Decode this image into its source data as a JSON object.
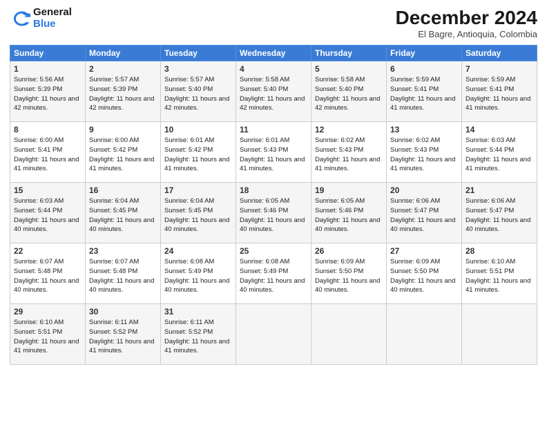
{
  "logo": {
    "general": "General",
    "blue": "Blue"
  },
  "title": "December 2024",
  "subtitle": "El Bagre, Antioquia, Colombia",
  "days_of_week": [
    "Sunday",
    "Monday",
    "Tuesday",
    "Wednesday",
    "Thursday",
    "Friday",
    "Saturday"
  ],
  "weeks": [
    [
      {
        "day": "1",
        "sunrise": "5:56 AM",
        "sunset": "5:39 PM",
        "daylight": "11 hours and 42 minutes."
      },
      {
        "day": "2",
        "sunrise": "5:57 AM",
        "sunset": "5:39 PM",
        "daylight": "11 hours and 42 minutes."
      },
      {
        "day": "3",
        "sunrise": "5:57 AM",
        "sunset": "5:40 PM",
        "daylight": "11 hours and 42 minutes."
      },
      {
        "day": "4",
        "sunrise": "5:58 AM",
        "sunset": "5:40 PM",
        "daylight": "11 hours and 42 minutes."
      },
      {
        "day": "5",
        "sunrise": "5:58 AM",
        "sunset": "5:40 PM",
        "daylight": "11 hours and 42 minutes."
      },
      {
        "day": "6",
        "sunrise": "5:59 AM",
        "sunset": "5:41 PM",
        "daylight": "11 hours and 41 minutes."
      },
      {
        "day": "7",
        "sunrise": "5:59 AM",
        "sunset": "5:41 PM",
        "daylight": "11 hours and 41 minutes."
      }
    ],
    [
      {
        "day": "8",
        "sunrise": "6:00 AM",
        "sunset": "5:41 PM",
        "daylight": "11 hours and 41 minutes."
      },
      {
        "day": "9",
        "sunrise": "6:00 AM",
        "sunset": "5:42 PM",
        "daylight": "11 hours and 41 minutes."
      },
      {
        "day": "10",
        "sunrise": "6:01 AM",
        "sunset": "5:42 PM",
        "daylight": "11 hours and 41 minutes."
      },
      {
        "day": "11",
        "sunrise": "6:01 AM",
        "sunset": "5:43 PM",
        "daylight": "11 hours and 41 minutes."
      },
      {
        "day": "12",
        "sunrise": "6:02 AM",
        "sunset": "5:43 PM",
        "daylight": "11 hours and 41 minutes."
      },
      {
        "day": "13",
        "sunrise": "6:02 AM",
        "sunset": "5:43 PM",
        "daylight": "11 hours and 41 minutes."
      },
      {
        "day": "14",
        "sunrise": "6:03 AM",
        "sunset": "5:44 PM",
        "daylight": "11 hours and 41 minutes."
      }
    ],
    [
      {
        "day": "15",
        "sunrise": "6:03 AM",
        "sunset": "5:44 PM",
        "daylight": "11 hours and 40 minutes."
      },
      {
        "day": "16",
        "sunrise": "6:04 AM",
        "sunset": "5:45 PM",
        "daylight": "11 hours and 40 minutes."
      },
      {
        "day": "17",
        "sunrise": "6:04 AM",
        "sunset": "5:45 PM",
        "daylight": "11 hours and 40 minutes."
      },
      {
        "day": "18",
        "sunrise": "6:05 AM",
        "sunset": "5:46 PM",
        "daylight": "11 hours and 40 minutes."
      },
      {
        "day": "19",
        "sunrise": "6:05 AM",
        "sunset": "5:46 PM",
        "daylight": "11 hours and 40 minutes."
      },
      {
        "day": "20",
        "sunrise": "6:06 AM",
        "sunset": "5:47 PM",
        "daylight": "11 hours and 40 minutes."
      },
      {
        "day": "21",
        "sunrise": "6:06 AM",
        "sunset": "5:47 PM",
        "daylight": "11 hours and 40 minutes."
      }
    ],
    [
      {
        "day": "22",
        "sunrise": "6:07 AM",
        "sunset": "5:48 PM",
        "daylight": "11 hours and 40 minutes."
      },
      {
        "day": "23",
        "sunrise": "6:07 AM",
        "sunset": "5:48 PM",
        "daylight": "11 hours and 40 minutes."
      },
      {
        "day": "24",
        "sunrise": "6:08 AM",
        "sunset": "5:49 PM",
        "daylight": "11 hours and 40 minutes."
      },
      {
        "day": "25",
        "sunrise": "6:08 AM",
        "sunset": "5:49 PM",
        "daylight": "11 hours and 40 minutes."
      },
      {
        "day": "26",
        "sunrise": "6:09 AM",
        "sunset": "5:50 PM",
        "daylight": "11 hours and 40 minutes."
      },
      {
        "day": "27",
        "sunrise": "6:09 AM",
        "sunset": "5:50 PM",
        "daylight": "11 hours and 40 minutes."
      },
      {
        "day": "28",
        "sunrise": "6:10 AM",
        "sunset": "5:51 PM",
        "daylight": "11 hours and 41 minutes."
      }
    ],
    [
      {
        "day": "29",
        "sunrise": "6:10 AM",
        "sunset": "5:51 PM",
        "daylight": "11 hours and 41 minutes."
      },
      {
        "day": "30",
        "sunrise": "6:11 AM",
        "sunset": "5:52 PM",
        "daylight": "11 hours and 41 minutes."
      },
      {
        "day": "31",
        "sunrise": "6:11 AM",
        "sunset": "5:52 PM",
        "daylight": "11 hours and 41 minutes."
      },
      null,
      null,
      null,
      null
    ]
  ],
  "labels": {
    "sunrise": "Sunrise:",
    "sunset": "Sunset:",
    "daylight": "Daylight:"
  }
}
